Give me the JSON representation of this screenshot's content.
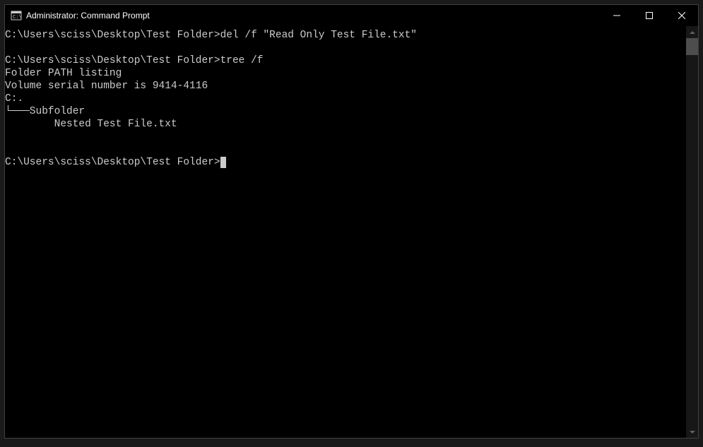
{
  "window": {
    "title": "Administrator: Command Prompt"
  },
  "terminal": {
    "lines": [
      {
        "prompt": "C:\\Users\\sciss\\Desktop\\Test Folder>",
        "command": "del /f \"Read Only Test File.txt\""
      },
      {
        "text": ""
      },
      {
        "prompt": "C:\\Users\\sciss\\Desktop\\Test Folder>",
        "command": "tree /f"
      },
      {
        "text": "Folder PATH listing"
      },
      {
        "text": "Volume serial number is 9414-4116"
      },
      {
        "text": "C:."
      },
      {
        "text": "└───Subfolder"
      },
      {
        "text": "        Nested Test File.txt"
      },
      {
        "text": ""
      },
      {
        "text": ""
      },
      {
        "prompt": "C:\\Users\\sciss\\Desktop\\Test Folder>",
        "command": "",
        "active": true
      }
    ]
  }
}
